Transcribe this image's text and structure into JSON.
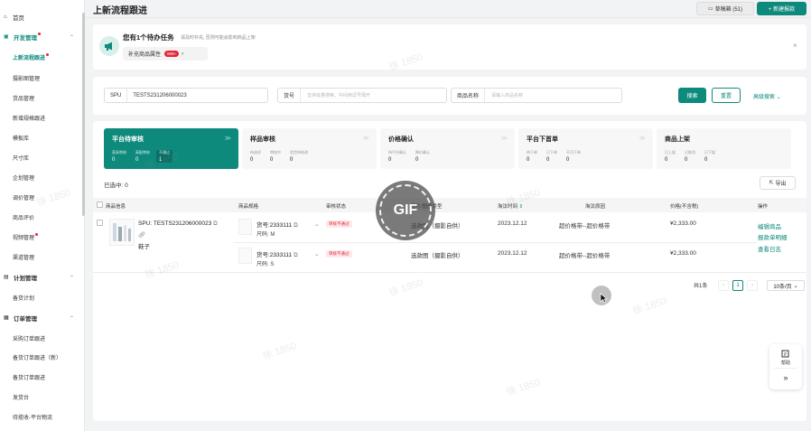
{
  "sidebar": {
    "home": "首页",
    "groups": [
      {
        "label": "开发管理",
        "has_dot": true,
        "items": [
          {
            "label": "上新流程跟进",
            "has_dot": true,
            "selected": true
          },
          {
            "label": "摄影图管理"
          },
          {
            "label": "货品管理"
          },
          {
            "label": "新增规格跟进"
          },
          {
            "label": "模板库"
          },
          {
            "label": "尺寸库"
          },
          {
            "label": "企划管理"
          },
          {
            "label": "调价管理"
          },
          {
            "label": "商品评价"
          },
          {
            "label": "视频管理",
            "has_dot": true
          },
          {
            "label": "渠道管理"
          }
        ]
      },
      {
        "label": "计划管理",
        "items": [
          {
            "label": "备货计划"
          }
        ]
      },
      {
        "label": "订单管理",
        "items": [
          {
            "label": "采购订单跟进"
          },
          {
            "label": "备货订单跟进（新）"
          },
          {
            "label": "备货订单跟进"
          },
          {
            "label": "发货台"
          },
          {
            "label": "待揽收-平台物流"
          }
        ]
      }
    ]
  },
  "header": {
    "title": "上新流程跟进",
    "draft_button": "草稿箱 (51)",
    "new_button": "+ 新建报款"
  },
  "task": {
    "title": "您有1个待办任务",
    "subtitle": "请及时补充, 否则可能会影响商品上架",
    "chip_label": "补充商品属性",
    "chip_badge": "999+"
  },
  "filters": {
    "spu_label": "SPU",
    "spu_value": "TESTS231206000023",
    "sku_label": "货号",
    "sku_placeholder": "支持批量搜索，中间用逗号隔开",
    "name_label": "商品名称",
    "name_placeholder": "请输入商品名称",
    "search": "搜索",
    "reset": "重置",
    "advanced": "高级搜索"
  },
  "stages": [
    {
      "title": "平台待审核",
      "metrics": [
        {
          "label": "直采审核",
          "value": "0"
        },
        {
          "label": "高配审核",
          "value": "0"
        },
        {
          "label": "不通过",
          "value": "1"
        }
      ]
    },
    {
      "title": "样品审核",
      "metrics": [
        {
          "label": "待选样",
          "value": "0"
        },
        {
          "label": "审核中",
          "value": "0"
        },
        {
          "label": "验货待修改",
          "value": "0"
        }
      ]
    },
    {
      "title": "价格确认",
      "metrics": [
        {
          "label": "待平台确认",
          "value": "0"
        },
        {
          "label": "降价确认",
          "value": "0"
        }
      ]
    },
    {
      "title": "平台下首单",
      "metrics": [
        {
          "label": "待下单",
          "value": "0"
        },
        {
          "label": "已下单",
          "value": "0"
        },
        {
          "label": "不可下单",
          "value": "0"
        }
      ]
    },
    {
      "title": "商品上架",
      "metrics": [
        {
          "label": "已上架",
          "value": "0"
        },
        {
          "label": "已取消",
          "value": "0"
        },
        {
          "label": "已下架",
          "value": "0"
        }
      ]
    }
  ],
  "list": {
    "selected": "已选中: 0",
    "export": "导出",
    "columns": [
      "商品信息",
      "商品规格",
      "审核状态",
      "图片/图册类型",
      "淘汰时间",
      "淘汰原因",
      "价格(不含税)",
      "操作"
    ],
    "product": {
      "spu": "SPU: TESTS231206000023",
      "name": "鞋子"
    },
    "skus": [
      {
        "code": "货号:2333111",
        "size": "尺码: M",
        "status": "审核不通过",
        "image_type": "选款图（摄影自供）",
        "time": "2023.12.12",
        "reason": "超价格带--超价格带",
        "price": "¥2,333.00"
      },
      {
        "code": "货号:2333111",
        "size": "尺码: S",
        "status": "审核不通过",
        "image_type": "选款图（摄影自供）",
        "time": "2023.12.12",
        "reason": "超价格带--超价格带",
        "price": "¥2,333.00"
      }
    ],
    "actions": [
      "编辑商品",
      "报款单明细",
      "查看日志"
    ]
  },
  "pagination": {
    "total": "共1条",
    "prev": "‹",
    "page": "1",
    "next": "›",
    "size": "10条/页"
  },
  "overlay": {
    "gif": "GIF"
  },
  "help": {
    "label": "帮助",
    "expand": "»"
  },
  "watermark": "徐 1850",
  "colors": {
    "accent": "#0e8a7c",
    "danger": "#e5253a"
  }
}
